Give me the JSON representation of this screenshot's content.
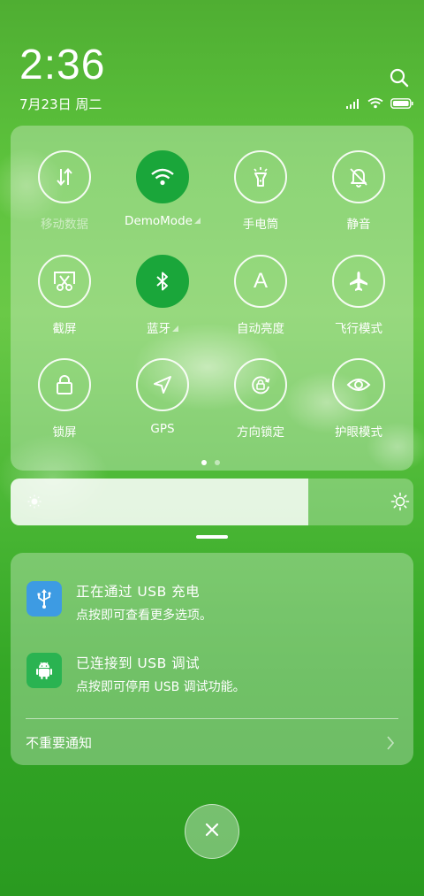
{
  "status": {
    "time": "2:36",
    "date": "7月23日 周二"
  },
  "quick_settings": {
    "tiles": [
      {
        "label": "移动数据",
        "icon": "mobile-data-icon",
        "state": "disabled"
      },
      {
        "label": "DemoMode",
        "icon": "wifi-icon",
        "state": "on"
      },
      {
        "label": "手电筒",
        "icon": "flashlight-icon",
        "state": "off"
      },
      {
        "label": "静音",
        "icon": "bell-mute-icon",
        "state": "off"
      },
      {
        "label": "截屏",
        "icon": "screenshot-icon",
        "state": "off"
      },
      {
        "label": "蓝牙",
        "icon": "bluetooth-icon",
        "state": "on"
      },
      {
        "label": "自动亮度",
        "icon": "auto-brightness-icon",
        "state": "off"
      },
      {
        "label": "飞行模式",
        "icon": "airplane-icon",
        "state": "off"
      },
      {
        "label": "锁屏",
        "icon": "lock-icon",
        "state": "off"
      },
      {
        "label": "GPS",
        "icon": "location-icon",
        "state": "off"
      },
      {
        "label": "方向锁定",
        "icon": "rotation-lock-icon",
        "state": "off"
      },
      {
        "label": "护眼模式",
        "icon": "eye-icon",
        "state": "off"
      }
    ],
    "auto_brightness_letter": "A",
    "page_count": 2,
    "active_page": 1
  },
  "brightness": {
    "level": 0.74
  },
  "notifications": [
    {
      "title": "正在通过 USB 充电",
      "body": "点按即可查看更多选项。",
      "icon": "usb-icon",
      "color": "#3d9be3"
    },
    {
      "title": "已连接到 USB 调试",
      "body": "点按即可停用 USB 调试功能。",
      "icon": "android-icon",
      "color": "#2ab351"
    }
  ],
  "unimportant_label": "不重要通知",
  "colors": {
    "accent": "#1aa63a"
  }
}
